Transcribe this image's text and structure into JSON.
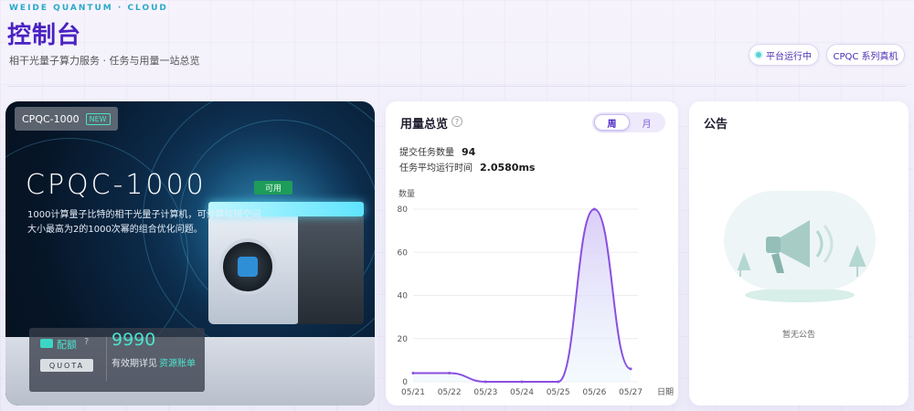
{
  "header": {
    "brand_tag": "WEIDE QUANTUM · CLOUD",
    "title": "控制台",
    "subtitle": "相干光量子算力服务 · 任务与用量一站总览",
    "status_pill": "平台运行中",
    "series_pill": "CPQC 系列真机"
  },
  "hero": {
    "tag": "CPQC-1000",
    "new_badge": "NEW",
    "model": "CPQC-1000",
    "availability": "可用",
    "description": "1000计算量子比特的相干光量子计算机，可计算规模空间大小最高为2的1000次幂的组合优化问题。",
    "quota": {
      "title": "配额",
      "wordmark": "QUOTA",
      "value": "9990",
      "expiry_label": "有效期详见",
      "link": "资源账单"
    }
  },
  "usage": {
    "title": "用量总览",
    "tabs": [
      {
        "label": "周",
        "active": true
      },
      {
        "label": "月",
        "active": false
      }
    ],
    "stats": {
      "tasks_label": "提交任务数量",
      "tasks_value": "94",
      "time_label": "任务平均运行时间",
      "time_value": "2.0580ms"
    }
  },
  "chart_data": {
    "type": "area",
    "x": [
      "05/21",
      "05/22",
      "05/23",
      "05/24",
      "05/25",
      "05/26",
      "05/27"
    ],
    "values": [
      4,
      4,
      0,
      0,
      0,
      80,
      6
    ],
    "xlabel": "日期",
    "ylabel": "数量",
    "ylim": [
      0,
      80
    ],
    "yticks": [
      0,
      20,
      40,
      60,
      80
    ],
    "grid": true,
    "colors": {
      "line": "#8a4fe0",
      "fill_top": "#d7c8f7",
      "fill_bottom": "#e8f6fd"
    }
  },
  "notice": {
    "title": "公告",
    "empty_text": "暂无公告"
  }
}
